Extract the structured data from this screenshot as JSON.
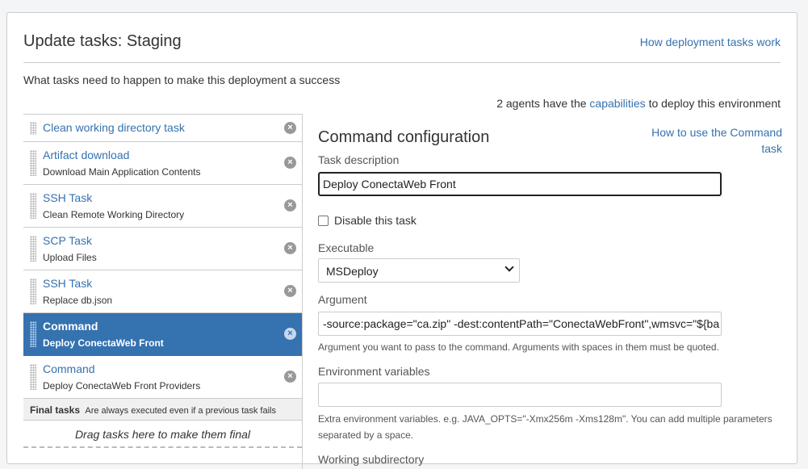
{
  "header": {
    "title": "Update tasks: Staging",
    "help_link": "How deployment tasks work",
    "subtitle": "What tasks need to happen to make this deployment a success",
    "agents_prefix": "2 agents have the",
    "agents_link": "capabilities",
    "agents_suffix": "to deploy this environment"
  },
  "tasks": [
    {
      "name": "Clean working directory task",
      "desc": ""
    },
    {
      "name": "Artifact download",
      "desc": "Download Main Application Contents"
    },
    {
      "name": "SSH Task",
      "desc": "Clean Remote Working Directory"
    },
    {
      "name": "SCP Task",
      "desc": "Upload Files"
    },
    {
      "name": "SSH Task",
      "desc": "Replace db.json"
    },
    {
      "name": "Command",
      "desc": "Deploy ConectaWeb Front"
    },
    {
      "name": "Command",
      "desc": "Deploy ConectaWeb Front Providers"
    }
  ],
  "final_tasks": {
    "label": "Final tasks",
    "note": "Are always executed even if a previous task fails",
    "drop_hint": "Drag tasks here to make them final"
  },
  "config": {
    "title": "Command configuration",
    "help_link": "How to use the Command task",
    "task_description_label": "Task description",
    "task_description_value": "Deploy ConectaWeb Front",
    "disable_label": "Disable this task",
    "executable_label": "Executable",
    "executable_value": "MSDeploy",
    "argument_label": "Argument",
    "argument_value": "-source:package=\"ca.zip\" -dest:contentPath=\"ConectaWebFront\",wmsvc=\"${ba",
    "argument_hint": "Argument you want to pass to the command. Arguments with spaces in them must be quoted.",
    "env_label": "Environment variables",
    "env_value": "",
    "env_hint": "Extra environment variables. e.g. JAVA_OPTS=\"-Xmx256m -Xms128m\". You can add multiple parameters separated by a space.",
    "workdir_label": "Working subdirectory"
  },
  "colors": {
    "link": "#3572b0",
    "selected_bg": "#3572b0"
  },
  "icons": {
    "remove": "close-circle-icon",
    "grip": "drag-handle-icon",
    "select": "chevron-down-icon"
  }
}
